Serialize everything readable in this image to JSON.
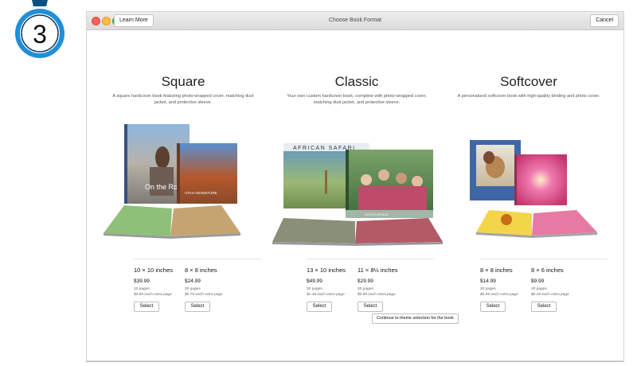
{
  "step": {
    "number": "3"
  },
  "window": {
    "title": "Choose Book Format",
    "learn_more": "Learn More",
    "cancel": "Cancel"
  },
  "formats": [
    {
      "title": "Square",
      "description": "A square hardcover book featuring photo-wrapped cover, matching dust jacket, and protective sleeve.",
      "cover_text_1": "On the Road",
      "cover_text_2": "UTAH ADVENTURE",
      "options": [
        {
          "size": "10 × 10 inches",
          "price": "$39.99",
          "pages": "20 pages",
          "extra": "$0.99 each extra page",
          "select": "Select"
        },
        {
          "size": "8 × 8 inches",
          "price": "$24.99",
          "pages": "20 pages",
          "extra": "$0.79 each extra page",
          "select": "Select"
        }
      ]
    },
    {
      "title": "Classic",
      "description": "Your own custom hardcover book, complete with photo-wrapped cover, matching dust jacket, and protective sleeve.",
      "cover_text_1": "AFRICAN SAFARI",
      "cover_text_2": "SOUTH AFRICA",
      "options": [
        {
          "size": "13 × 10 inches",
          "price": "$49.99",
          "pages": "20 pages",
          "extra": "$1.49 each extra page",
          "select": "Select"
        },
        {
          "size": "11 × 8½ inches",
          "price": "$29.99",
          "pages": "20 pages",
          "extra": "$0.99 each extra page",
          "select": "Select"
        }
      ]
    },
    {
      "title": "Softcover",
      "description": "A personalized softcover book with high-quality binding and photo cover.",
      "options": [
        {
          "size": "8 × 8 inches",
          "price": "$14.99",
          "pages": "20 pages",
          "extra": "$0.59 each extra page",
          "select": "Select"
        },
        {
          "size": "8 × 6 inches",
          "price": "$9.99",
          "pages": "20 pages",
          "extra": "$0.49 each extra page",
          "select": "Select"
        }
      ]
    }
  ],
  "continue_label": "Continue to theme selection for the book",
  "colors": {
    "badge_blue": "#1f8fd8",
    "badge_dark": "#0a3a5e"
  }
}
